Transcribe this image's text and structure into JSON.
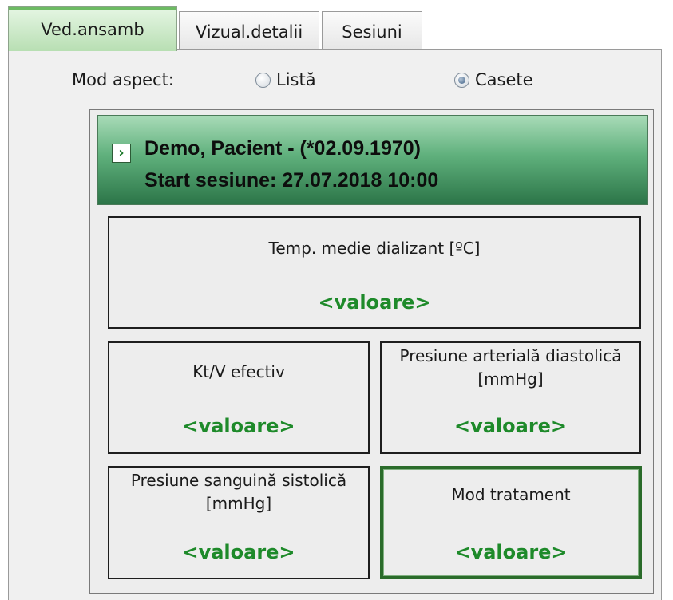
{
  "tabs": [
    {
      "label": "Ved.ansamb",
      "active": true
    },
    {
      "label": "Vizual.detalii",
      "active": false
    },
    {
      "label": "Sesiuni",
      "active": false
    }
  ],
  "view_mode": {
    "label": "Mod aspect:",
    "options": [
      {
        "label": "Listă",
        "checked": false
      },
      {
        "label": "Casete",
        "checked": true
      }
    ]
  },
  "patient": {
    "name_line": "Demo, Pacient - (*02.09.1970)",
    "session_line": "Start sesiune: 27.07.2018 10:00",
    "header_color": "#3f9160"
  },
  "boxes": [
    {
      "label": "Temp. medie dializant [ºC]",
      "value": "<valoare>"
    },
    {
      "label": "Kt/V efectiv",
      "value": "<valoare>"
    },
    {
      "label": "Presiune arterială diastolică [mmHg]",
      "value": "<valoare>"
    },
    {
      "label": "Presiune sanguină sistolică [mmHg]",
      "value": "<valoare>"
    },
    {
      "label": "Mod tratament",
      "value": "<valoare>"
    }
  ],
  "colors": {
    "value_text": "#1e8a2a",
    "active_tab": "#b8dfb3",
    "selected_box_border": "#2a6b2a"
  }
}
